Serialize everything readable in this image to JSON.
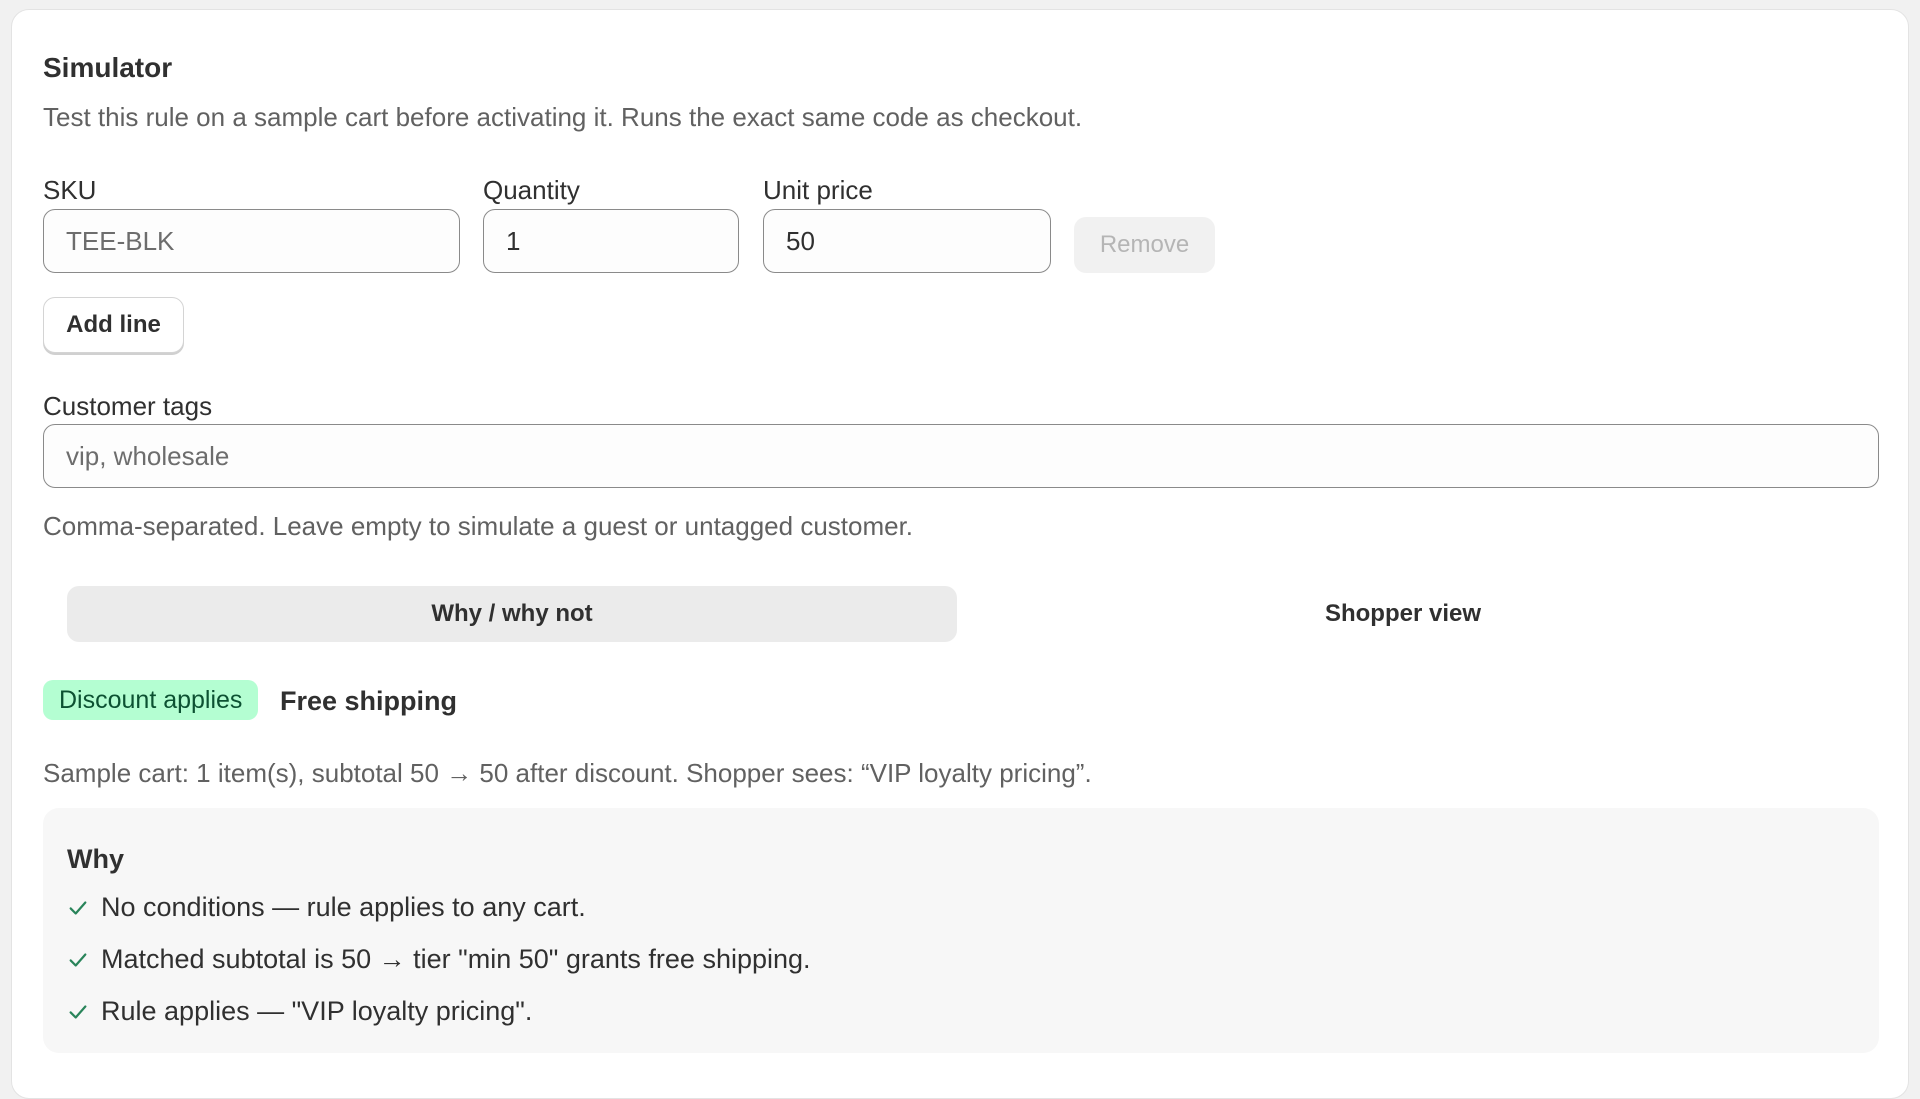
{
  "simulator": {
    "title": "Simulator",
    "description": "Test this rule on a sample cart before activating it. Runs the exact same code as checkout."
  },
  "line": {
    "sku_label": "SKU",
    "sku_placeholder": "TEE-BLK",
    "quantity_label": "Quantity",
    "quantity_value": "1",
    "unit_price_label": "Unit price",
    "unit_price_value": "50",
    "remove_label": "Remove"
  },
  "add_line_label": "Add line",
  "customer_tags": {
    "label": "Customer tags",
    "placeholder": "vip, wholesale",
    "help": "Comma-separated. Leave empty to simulate a guest or untagged customer."
  },
  "tabs": [
    {
      "label": "Why / why not",
      "active": true
    },
    {
      "label": "Shopper view",
      "active": false
    }
  ],
  "result": {
    "badge": "Discount applies",
    "badge_color": "#b4fed2",
    "benefit": "Free shipping",
    "summary": "Sample cart: 1 item(s), subtotal 50 → 50 after discount. Shopper sees: “VIP loyalty pricing”."
  },
  "why": {
    "title": "Why",
    "items": [
      {
        "icon": "check-icon",
        "text": "No conditions — rule applies to any cart."
      },
      {
        "icon": "check-icon",
        "text": "Matched subtotal is 50 → tier \"min 50\" grants free shipping."
      },
      {
        "icon": "check-icon",
        "text": "Rule applies — \"VIP loyalty pricing\"."
      }
    ]
  }
}
